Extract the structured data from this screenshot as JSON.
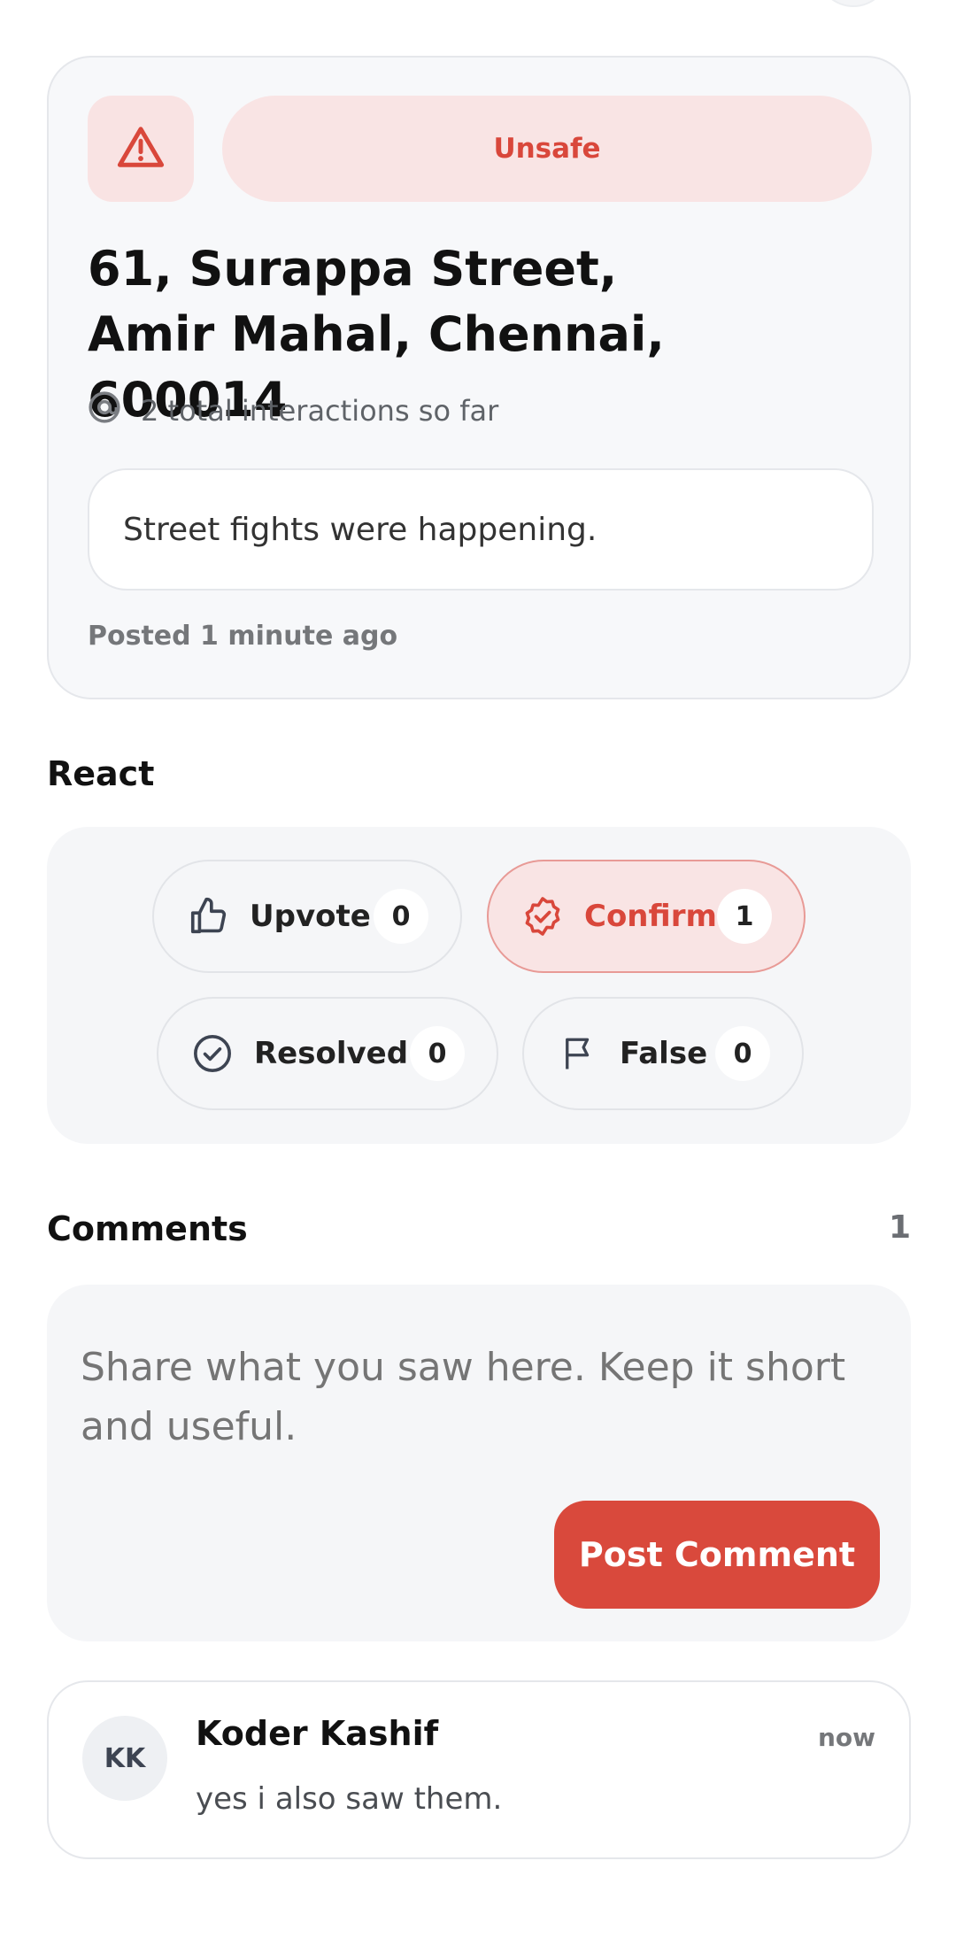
{
  "report": {
    "status_label": "Unsafe",
    "address": "61, Surappa Street, Amir Mahal, Chennai, 600014",
    "interactions_text": "2 total interactions so far",
    "description": "Street fights were happening.",
    "posted": "Posted 1 minute ago",
    "icons": {
      "status": "warning-triangle-icon",
      "interactions": "at-target-icon"
    }
  },
  "react": {
    "title": "React",
    "buttons": [
      {
        "label": "Upvote",
        "count": "0",
        "icon": "thumbs-up-icon",
        "active": false
      },
      {
        "label": "Confirm",
        "count": "1",
        "icon": "verified-badge-icon",
        "active": true
      },
      {
        "label": "Resolved",
        "count": "0",
        "icon": "check-circle-icon",
        "active": false
      },
      {
        "label": "False",
        "count": "0",
        "icon": "flag-icon",
        "active": false
      }
    ]
  },
  "comments": {
    "title": "Comments",
    "count": "1",
    "placeholder": "Share what you saw here. Keep it short and useful.",
    "post_label": "Post Comment",
    "items": [
      {
        "initials": "KK",
        "author": "Koder Kashif",
        "time": "now",
        "text": "yes i also saw them."
      }
    ]
  },
  "colors": {
    "accent": "#d9493c",
    "accent_soft": "#f9e4e4",
    "panel": "#f5f6f8",
    "border": "#e5e7eb"
  }
}
